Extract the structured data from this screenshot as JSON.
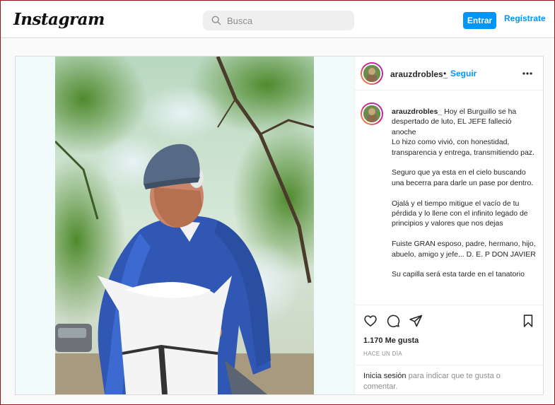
{
  "header": {
    "logo": "Instagram",
    "search_placeholder": "Busca",
    "login_label": "Entrar",
    "register_label": "Regístrate"
  },
  "post": {
    "username": "arauzdrobles_",
    "dot": "•",
    "follow_label": "Seguir",
    "caption_paragraphs": [
      "Hoy el Burguillo se ha despertado de luto, EL JEFE falleció anoche\nLo hizo como vivió, con honestidad, transparencia y entrega, transmitiendo paz.",
      "Seguro que ya esta en el cielo buscando una becerra para darle un pase por dentro.",
      "Ojalá y el tiempo mitigue el vacío de tu pérdida y lo llene con el infinito legado de principios y valores que nos dejas",
      "Fuiste GRAN esposo, padre, hermano, hijo, abuelo, amigo y jefe... D. E. P DON JAVIER",
      "Su capilla será esta tarde en el tanatorio"
    ],
    "likes": "1.170 Me gusta",
    "time_ago": "HACE UN DÍA",
    "login_prompt": {
      "link": "Inicia sesión",
      "rest": "para indicar que te gusta o comentar."
    }
  },
  "colors": {
    "accent": "#0095f6",
    "border": "#dbdbdb",
    "text": "#262626",
    "muted": "#8e8e8e"
  }
}
